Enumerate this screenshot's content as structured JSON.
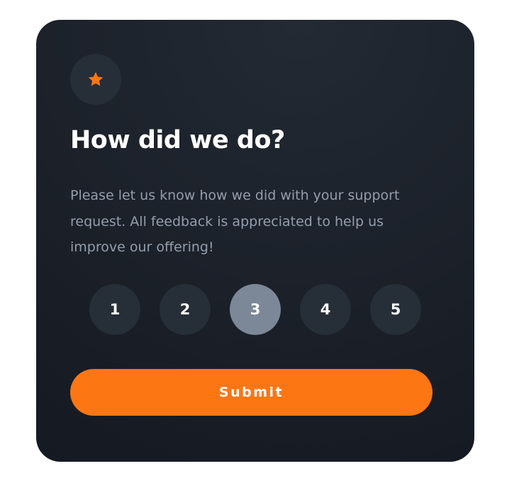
{
  "card": {
    "icon": "star-icon",
    "title": "How did we do?",
    "description": "Please let us know how we did with your support request. All feedback is appreciated to help us improve our offering!",
    "ratings": [
      "1",
      "2",
      "3",
      "4",
      "5"
    ],
    "selected_rating": 3,
    "submit_label": "Submit"
  },
  "colors": {
    "accent": "#fc7614",
    "card_bg": "#1b2029",
    "circle_bg": "#262e38",
    "selected_bg": "#7c8798",
    "text_muted": "#959eac"
  }
}
